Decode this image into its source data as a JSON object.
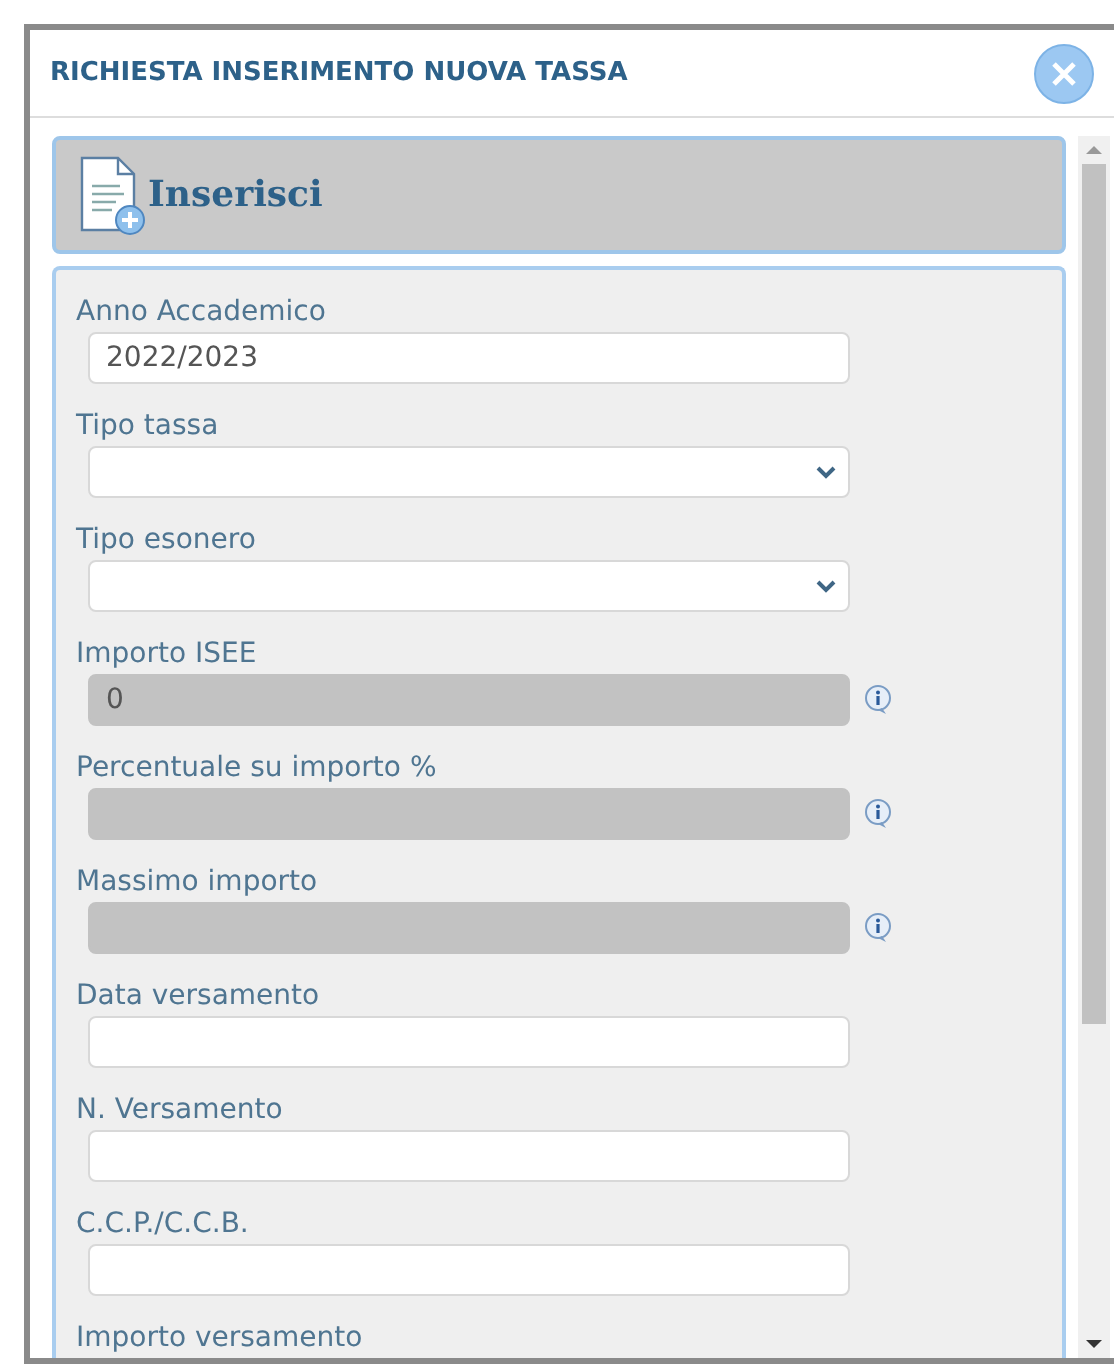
{
  "window": {
    "title": "RICHIESTA INSERIMENTO NUOVA TASSA"
  },
  "header": {
    "label": "Inserisci"
  },
  "fields": [
    {
      "kind": "text",
      "label": "Anno Accademico",
      "value": "2022/2023",
      "disabled": false
    },
    {
      "kind": "select",
      "label": "Tipo tassa",
      "disabled": false
    },
    {
      "kind": "select",
      "label": "Tipo esonero",
      "disabled": false
    },
    {
      "kind": "text",
      "label": "Importo ISEE",
      "value": "0",
      "disabled": true
    },
    {
      "kind": "text",
      "label": "Percentuale su importo %",
      "disabled": true
    },
    {
      "kind": "text",
      "label": "Massimo importo",
      "disabled": true
    },
    {
      "kind": "text",
      "label": "Data versamento",
      "disabled": false
    },
    {
      "kind": "text",
      "label": "N. Versamento",
      "disabled": false
    },
    {
      "kind": "text",
      "label": "C.C.P./C.C.B.",
      "disabled": false
    },
    {
      "kind": "label",
      "label": "Importo versamento"
    }
  ]
}
